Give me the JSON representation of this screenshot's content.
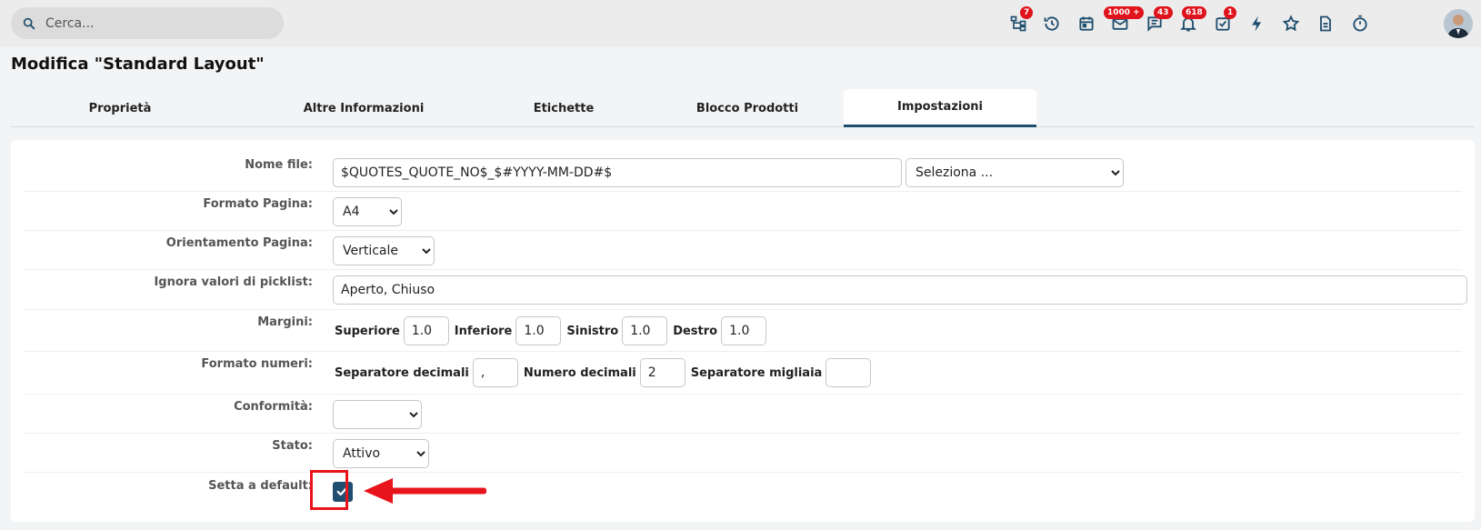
{
  "search": {
    "placeholder": "Cerca..."
  },
  "topbar": {
    "icons": [
      {
        "name": "hierarchy-icon",
        "badge": "7"
      },
      {
        "name": "history-icon",
        "badge": ""
      },
      {
        "name": "calendar-icon",
        "badge": ""
      },
      {
        "name": "mail-icon",
        "badge": "1000 +"
      },
      {
        "name": "chat-icon",
        "badge": "43"
      },
      {
        "name": "bell-icon",
        "badge": "618"
      },
      {
        "name": "task-check-icon",
        "badge": "1"
      },
      {
        "name": "lightning-icon",
        "badge": ""
      },
      {
        "name": "star-icon",
        "badge": ""
      },
      {
        "name": "document-icon",
        "badge": ""
      },
      {
        "name": "timer-icon",
        "badge": ""
      }
    ]
  },
  "page": {
    "title": "Modifica \"Standard Layout\""
  },
  "tabs": [
    {
      "label": "Proprietà"
    },
    {
      "label": "Altre Informazioni"
    },
    {
      "label": "Etichette"
    },
    {
      "label": "Blocco Prodotti"
    },
    {
      "label": "Impostazioni"
    }
  ],
  "form": {
    "nome_file": {
      "label": "Nome file:",
      "value": "$QUOTES_QUOTE_NO$_$#YYYY-MM-DD#$",
      "select": "Seleziona ..."
    },
    "formato_pagina": {
      "label": "Formato Pagina:",
      "value": "A4"
    },
    "orientamento": {
      "label": "Orientamento Pagina:",
      "value": "Verticale"
    },
    "ignora": {
      "label": "Ignora valori di picklist:",
      "value": "Aperto, Chiuso"
    },
    "margini": {
      "label": "Margini:",
      "superiore_label": "Superiore",
      "superiore": "1.0",
      "inferiore_label": "Inferiore",
      "inferiore": "1.0",
      "sinistro_label": "Sinistro",
      "sinistro": "1.0",
      "destro_label": "Destro",
      "destro": "1.0"
    },
    "formato_numeri": {
      "label": "Formato numeri:",
      "sep_dec_label": "Separatore decimali",
      "sep_dec": ",",
      "num_dec_label": "Numero decimali",
      "num_dec": "2",
      "sep_mig_label": "Separatore migliaia",
      "sep_mig": ""
    },
    "conformita": {
      "label": "Conformità:",
      "value": ""
    },
    "stato": {
      "label": "Stato:",
      "value": "Attivo"
    },
    "default": {
      "label": "Setta a default:",
      "checked": true
    }
  },
  "colors": {
    "accent": "#1f4e6e",
    "badge": "#e0121b",
    "highlight": "#e8141b"
  }
}
